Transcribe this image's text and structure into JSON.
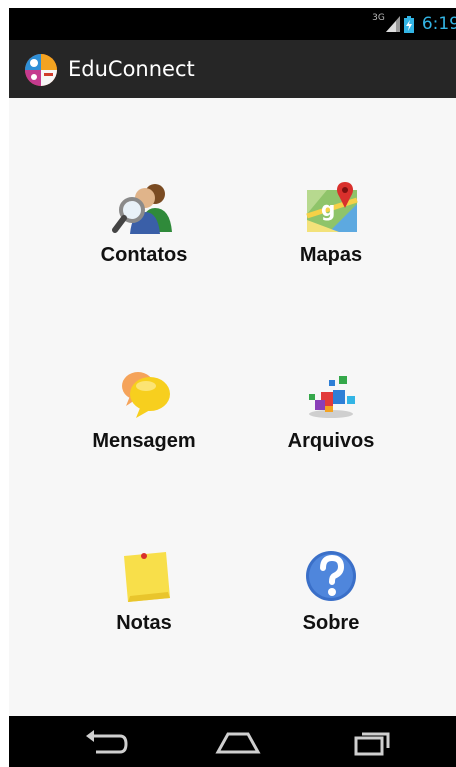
{
  "status": {
    "network": "3G",
    "time": "6:19"
  },
  "app": {
    "title": "EduConnect"
  },
  "menu": [
    {
      "label": "Contatos",
      "icon": "contacts-icon"
    },
    {
      "label": "Mapas",
      "icon": "maps-icon"
    },
    {
      "label": "Mensagem",
      "icon": "messages-icon"
    },
    {
      "label": "Arquivos",
      "icon": "files-icon"
    },
    {
      "label": "Notas",
      "icon": "notes-icon"
    },
    {
      "label": "Sobre",
      "icon": "help-icon"
    }
  ],
  "navbar": {
    "icons": [
      "back-icon",
      "home-icon",
      "recent-apps-icon"
    ]
  },
  "colors": {
    "clock": "#33b5e5",
    "action_bar": "#262626",
    "background": "#f7f7f7"
  }
}
